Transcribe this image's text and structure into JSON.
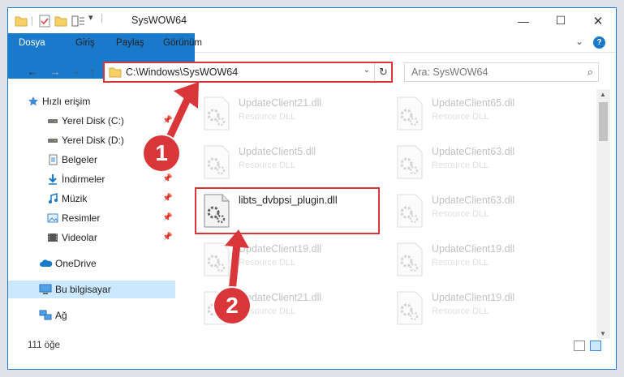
{
  "window": {
    "title": "SysWOW64",
    "controls": {
      "minimize": "—",
      "maximize": "☐",
      "close": "✕"
    }
  },
  "ribbon": {
    "tabs": [
      "Dosya",
      "Giriş",
      "Paylaş",
      "Görünüm"
    ],
    "expand_glyph": "⌄",
    "help_glyph": "?"
  },
  "nav": {
    "back": "←",
    "forward": "→",
    "recent": "⌄",
    "up": "↑",
    "address_path": "C:\\Windows\\SysWOW64",
    "address_dropdown": "⌄",
    "refresh": "↻",
    "search_placeholder": "Ara: SysWOW64",
    "search_icon": "⌕"
  },
  "sidebar": {
    "items": [
      {
        "label": "Hızlı erişim",
        "icon": "star-icon",
        "pinned": false
      },
      {
        "label": "Yerel Disk (C:)",
        "icon": "drive-icon",
        "pinned": true
      },
      {
        "label": "Yerel Disk (D:)",
        "icon": "drive-icon",
        "pinned": true
      },
      {
        "label": "Belgeler",
        "icon": "documents-icon",
        "pinned": true
      },
      {
        "label": "İndirmeler",
        "icon": "download-icon",
        "pinned": true
      },
      {
        "label": "Müzik",
        "icon": "music-icon",
        "pinned": true
      },
      {
        "label": "Resimler",
        "icon": "pictures-icon",
        "pinned": true
      },
      {
        "label": "Videolar",
        "icon": "videos-icon",
        "pinned": true
      },
      {
        "label": "OneDrive",
        "icon": "cloud-icon",
        "pinned": false
      },
      {
        "label": "Bu bilgisayar",
        "icon": "computer-icon",
        "pinned": false
      },
      {
        "label": "Ağ",
        "icon": "network-icon",
        "pinned": false
      }
    ],
    "pin_glyph": "📌"
  },
  "files": [
    {
      "name": "UpdateClient21.dll",
      "type": "Resource DLL",
      "faded": true
    },
    {
      "name": "UpdateClient65.dll",
      "type": "Resource DLL",
      "faded": true
    },
    {
      "name": "UpdateClient5.dll",
      "type": "Resource DLL",
      "faded": true
    },
    {
      "name": "UpdateClient63.dll",
      "type": "Resource DLL",
      "faded": true
    },
    {
      "name": "libts_dvbpsi_plugin.dll",
      "type": "",
      "faded": false
    },
    {
      "name": "UpdateClient63.dll",
      "type": "Resource DLL",
      "faded": true
    },
    {
      "name": "UpdateClient19.dll",
      "type": "Resource DLL",
      "faded": true
    },
    {
      "name": "UpdateClient19.dll",
      "type": "Resource DLL",
      "faded": true
    },
    {
      "name": "UpdateClient21.dll",
      "type": "Resource DLL",
      "faded": true
    },
    {
      "name": "UpdateClient19.dll",
      "type": "Resource DLL",
      "faded": true
    }
  ],
  "status": {
    "item_count": "111 öğe"
  },
  "annotations": {
    "step1": "1",
    "step2": "2",
    "color": "#d9363a"
  },
  "colors": {
    "accent": "#1979ca",
    "selection": "#cce8ff"
  }
}
